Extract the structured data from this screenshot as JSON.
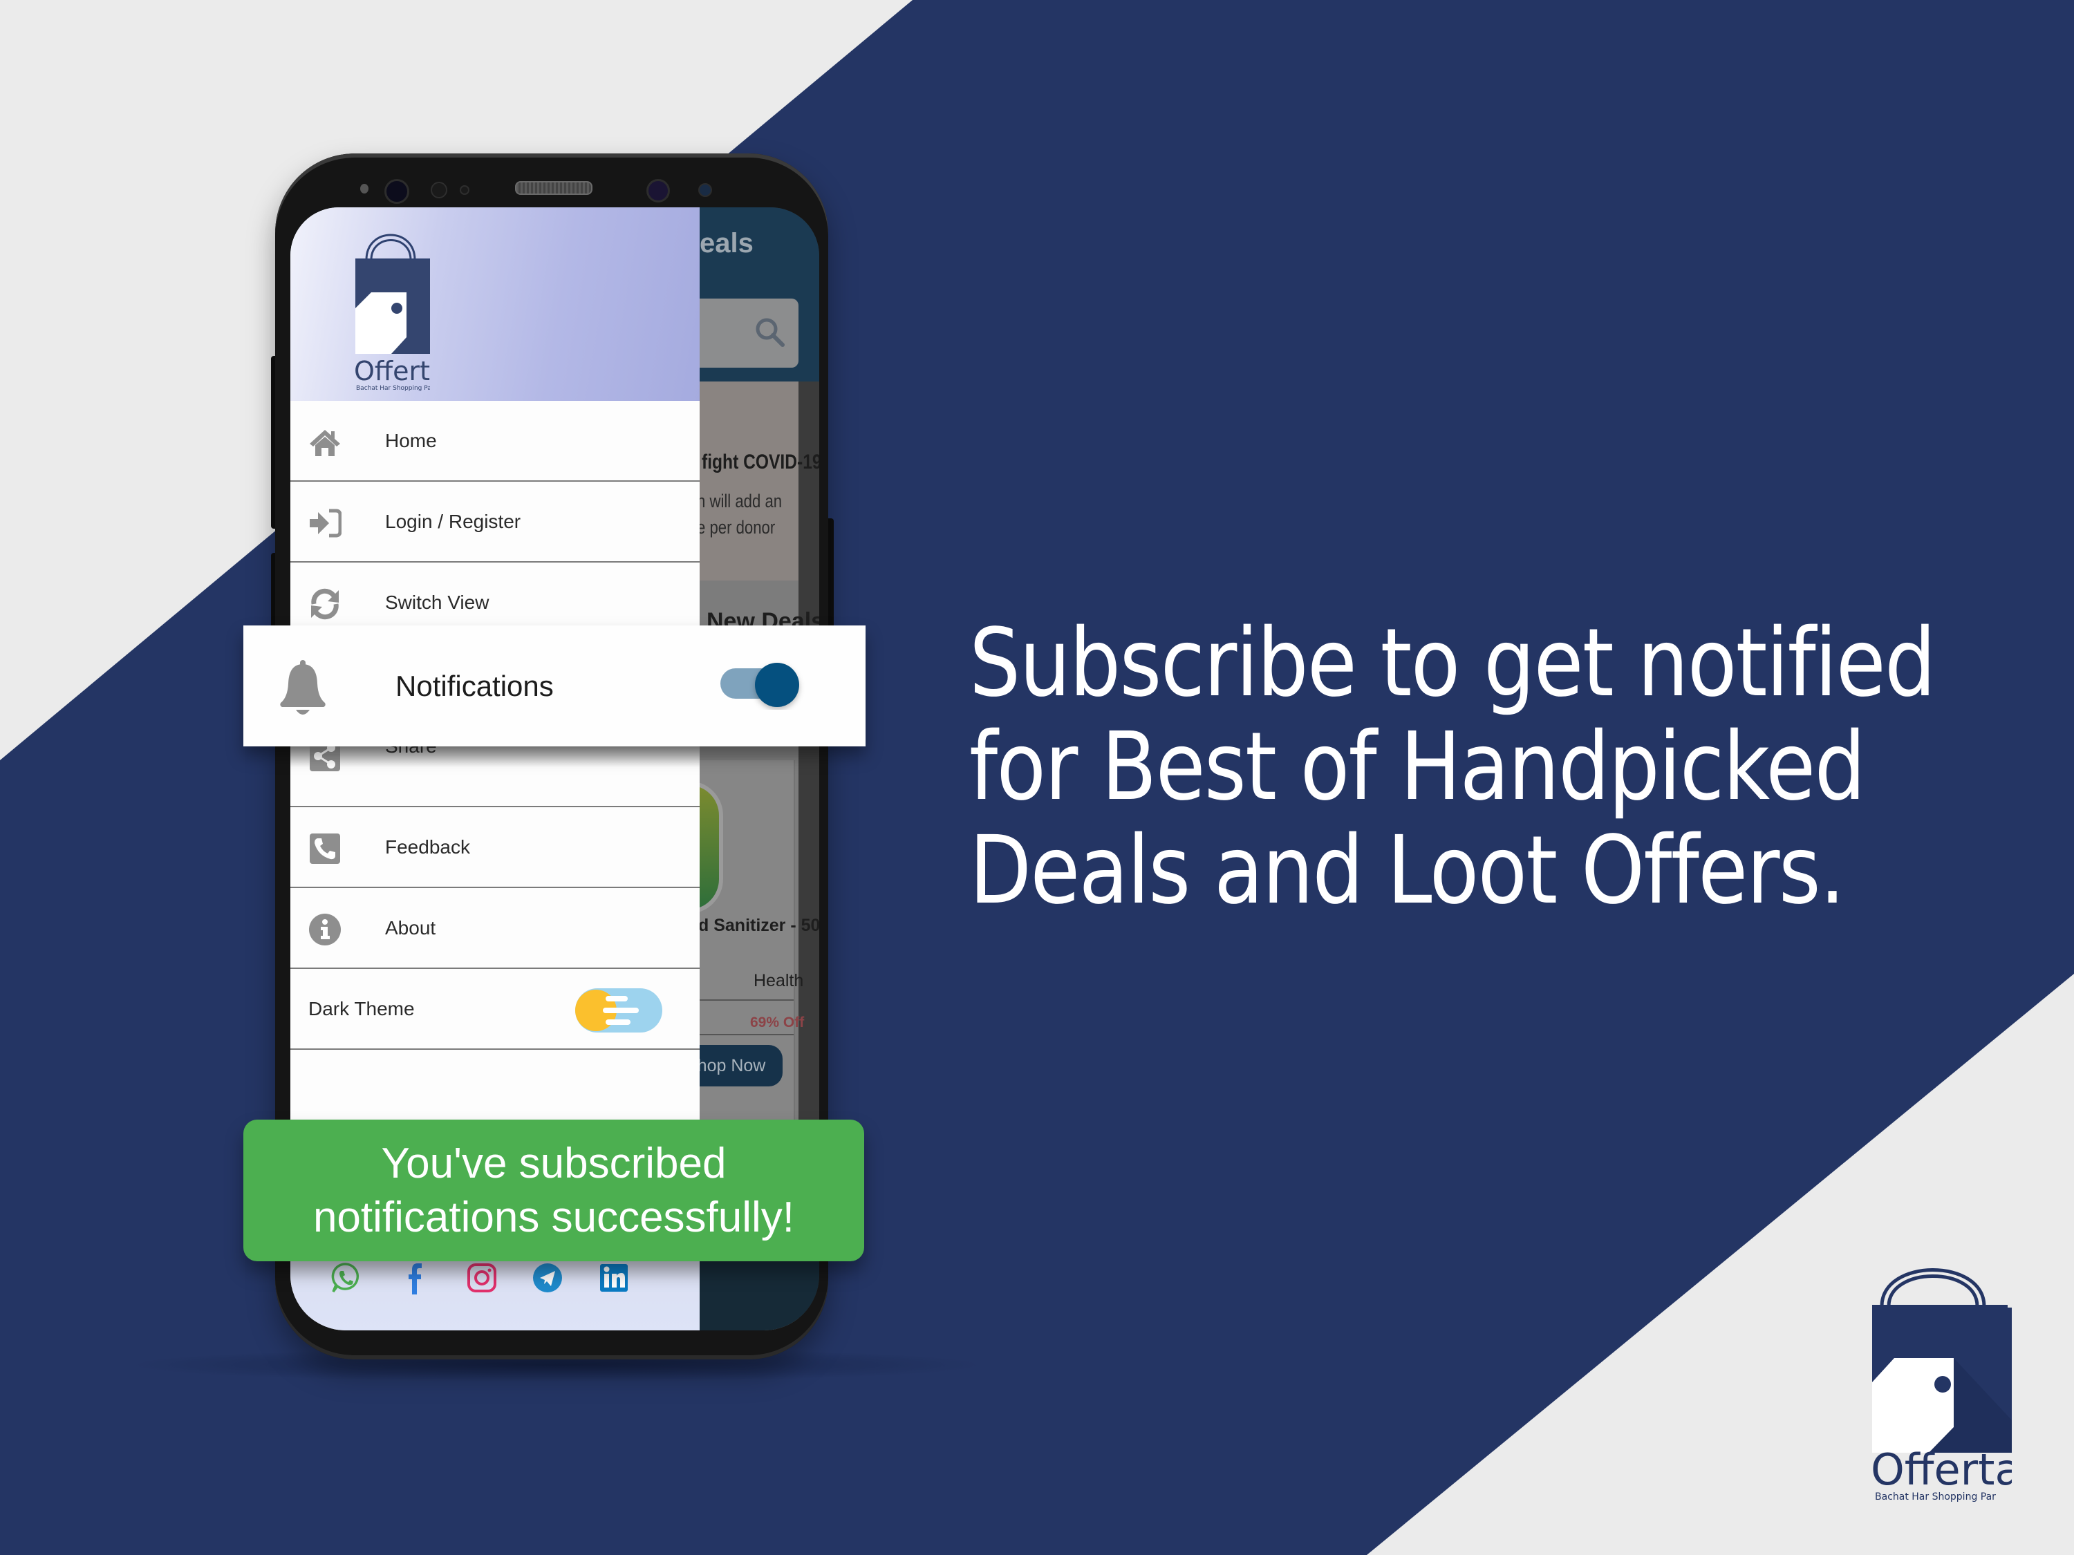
{
  "colors": {
    "brand_navy": "#243564",
    "background_light": "#ebebeb",
    "toast_green": "#4caf50",
    "toggle_on_thumb": "#05507f",
    "toggle_on_track": "#7fa3bd",
    "dark_theme_sun": "#fbc02d",
    "dark_theme_track": "#9dd3ee",
    "discount_red": "#8c4347",
    "app_bar": "#1b3a52"
  },
  "brand": {
    "name": "Offertag",
    "tagline": "Bachat Har Shopping Par"
  },
  "headline": {
    "lines": [
      "Subscribe to get notified",
      "for Best of Handpicked",
      "Deals and Loot Offers."
    ]
  },
  "background_app": {
    "title_fragment": "eals",
    "search_icon": "search-icon",
    "banner_title": "fight COVID-19",
    "banner_line1": "n will add an",
    "banner_line2": "e per donor",
    "section_title": "New Deals",
    "product_name": "d Sanitizer - 50",
    "category": "Health",
    "discount": "69% Off",
    "shop_button": "Shop Now"
  },
  "drawer": {
    "menu_items": [
      {
        "label": "Home",
        "icon": "home-icon"
      },
      {
        "label": "Login / Register",
        "icon": "sign-in-icon"
      },
      {
        "label": "Switch View",
        "icon": "refresh-icon"
      },
      {
        "label": "Share",
        "icon": "share-icon"
      },
      {
        "label": "Feedback",
        "icon": "phone-icon"
      },
      {
        "label": "About",
        "icon": "info-icon"
      }
    ],
    "dark_theme": {
      "label": "Dark Theme",
      "enabled": false
    },
    "social_links": [
      {
        "name": "WhatsApp",
        "icon": "whatsapp-icon"
      },
      {
        "name": "Facebook",
        "icon": "facebook-icon"
      },
      {
        "name": "Instagram",
        "icon": "instagram-icon"
      },
      {
        "name": "Telegram",
        "icon": "telegram-icon"
      },
      {
        "name": "LinkedIn",
        "icon": "linkedin-icon"
      }
    ]
  },
  "notification_card": {
    "label": "Notifications",
    "icon": "bell-icon",
    "enabled": true
  },
  "toast": {
    "line1": "You've subscribed",
    "line2": "notifications successfully!"
  }
}
